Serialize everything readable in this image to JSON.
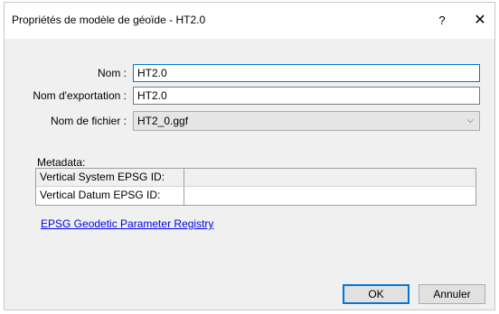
{
  "dialog": {
    "title": "Propriétés de modèle de géoïde - HT2.0",
    "help_label": "?",
    "close_label": "✕"
  },
  "form": {
    "name_label": "Nom :",
    "name_value": "HT2.0",
    "export_label": "Nom d'exportation :",
    "export_value": "HT2.0",
    "file_label": "Nom de fichier :",
    "file_value": "HT2_0.ggf"
  },
  "metadata": {
    "label": "Metadata:",
    "rows": [
      {
        "name": "Vertical System EPSG ID:",
        "value": ""
      },
      {
        "name": "Vertical Datum EPSG ID:",
        "value": ""
      }
    ]
  },
  "link_text": "EPSG Geodetic Parameter Registry",
  "buttons": {
    "ok": "OK",
    "cancel": "Annuler"
  }
}
